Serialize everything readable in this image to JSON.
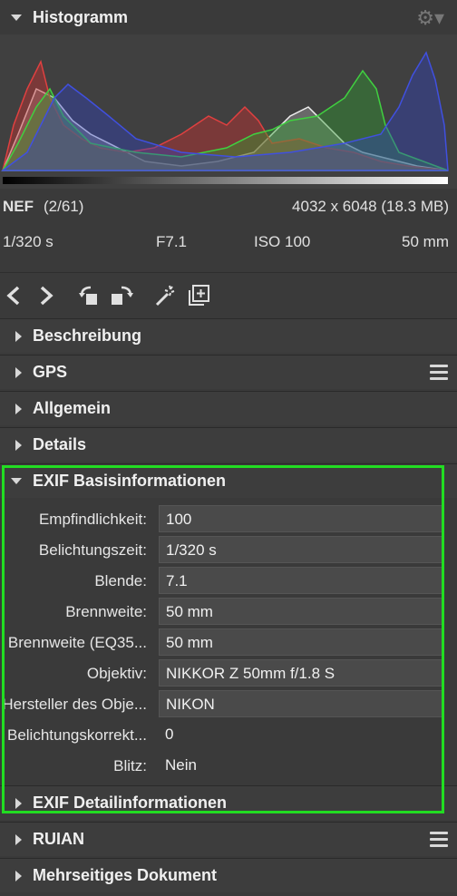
{
  "histogram": {
    "title": "Histogramm",
    "icon": "gear-icon"
  },
  "file_info": {
    "format": "NEF",
    "index": "(2/61)",
    "dimensions": "4032 x 6048 (18.3 MB)",
    "shutter": "1/320 s",
    "aperture": "F7.1",
    "iso": "ISO 100",
    "focal": "50 mm"
  },
  "toolbar": {
    "icons": [
      "chevron-left-icon",
      "chevron-right-icon",
      "rotate-left-icon",
      "rotate-right-icon",
      "magic-wand-icon",
      "add-page-icon"
    ]
  },
  "sections": {
    "beschreibung": "Beschreibung",
    "gps": "GPS",
    "allgemein": "Allgemein",
    "details": "Details",
    "exif_basis": "EXIF Basisinformationen",
    "exif_detail": "EXIF Detailinformationen",
    "ruian": "RUIAN",
    "mehrseitig": "Mehrseitiges Dokument"
  },
  "exif_rows": [
    {
      "label": "Empfindlichkeit:",
      "value": "100"
    },
    {
      "label": "Belichtungszeit:",
      "value": "1/320 s"
    },
    {
      "label": "Blende:",
      "value": "7.1"
    },
    {
      "label": "Brennweite:",
      "value": "50 mm"
    },
    {
      "label": "Brennweite (EQ35...",
      "value": "50 mm"
    },
    {
      "label": "Objektiv:",
      "value": "NIKKOR Z 50mm f/1.8 S"
    },
    {
      "label": "Hersteller des Obje...",
      "value": "NIKON"
    },
    {
      "label": "Belichtungskorrekt...",
      "value": "0"
    },
    {
      "label": "Blitz:",
      "value": "Nein"
    }
  ],
  "colors": {
    "accent_frame": "#22dd22",
    "red": "#e04040",
    "green": "#40d040",
    "blue": "#4050e0"
  }
}
